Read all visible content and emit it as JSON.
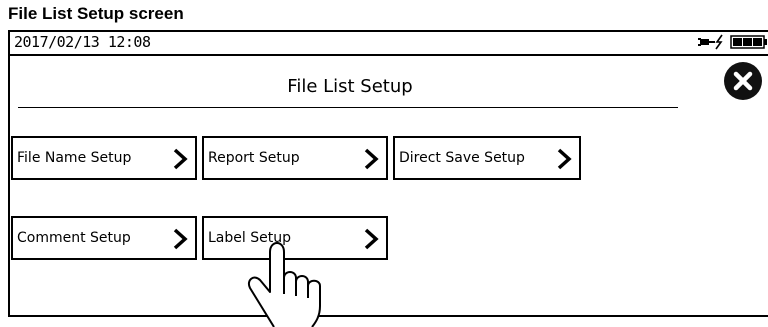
{
  "caption": "File List Setup screen",
  "status_bar": {
    "datetime": "2017/02/13 12:08",
    "icons": [
      "ac-power-icon",
      "battery-full-icon"
    ]
  },
  "header": {
    "title": "File List Setup",
    "close_icon": "close-icon"
  },
  "buttons": [
    {
      "label": "File Name Setup",
      "icon": "chevron-right-icon"
    },
    {
      "label": "Report Setup",
      "icon": "chevron-right-icon"
    },
    {
      "label": "Direct Save Setup",
      "icon": "chevron-right-icon"
    },
    {
      "label": "Comment Setup",
      "icon": "chevron-right-icon"
    },
    {
      "label": "Label Setup",
      "icon": "chevron-right-icon"
    }
  ],
  "overlay": {
    "icon": "pointing-hand-icon"
  }
}
